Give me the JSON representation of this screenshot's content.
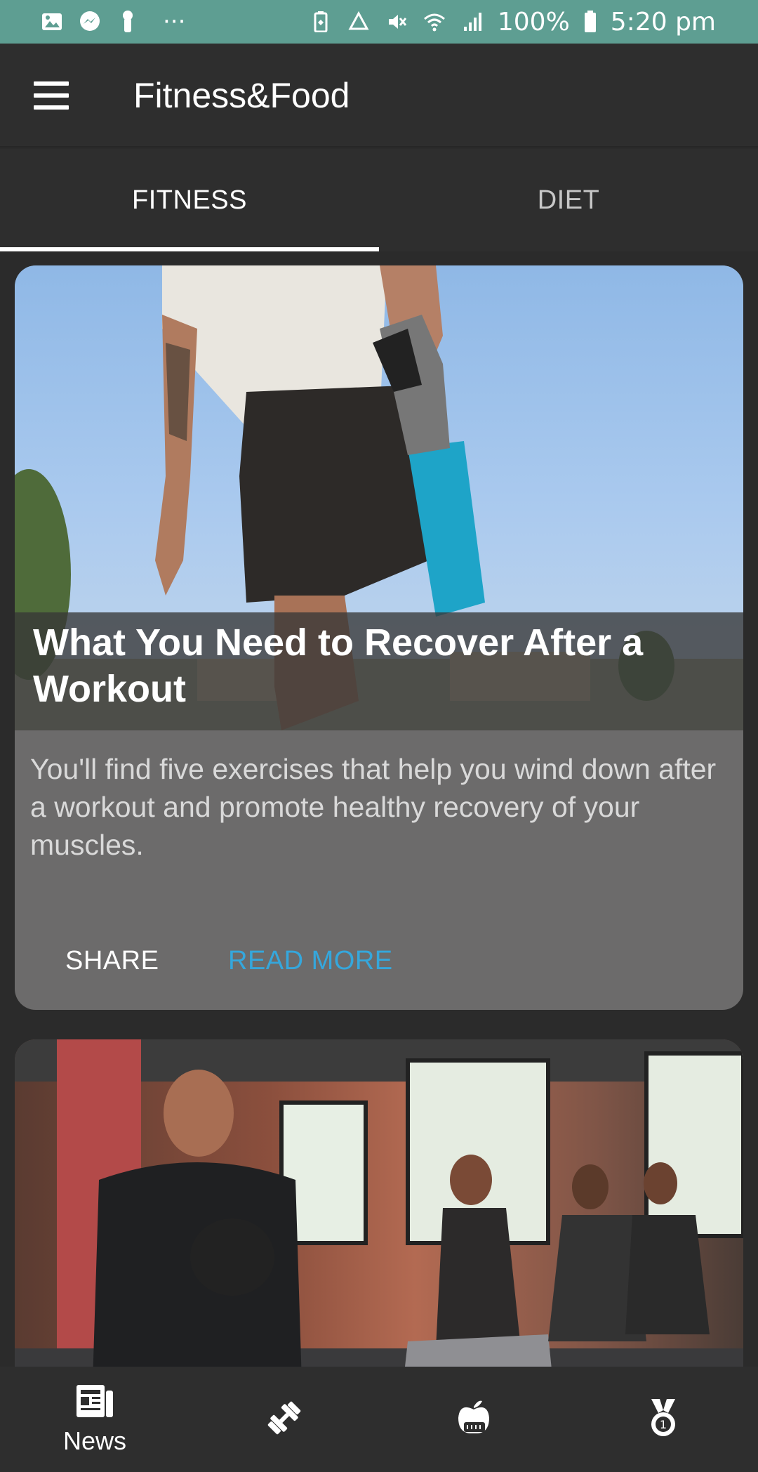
{
  "status_bar": {
    "dots": "···",
    "battery": "100%",
    "time": "5:20 pm",
    "icons": [
      "image-icon",
      "messenger-icon",
      "notification-icon",
      "battery-saver-icon",
      "recycle-icon",
      "mute-icon",
      "wifi-icon",
      "signal-icon",
      "battery-icon"
    ]
  },
  "appbar": {
    "title": "Fitness&Food",
    "menu_icon": "menu-icon"
  },
  "tabs": [
    {
      "label": "FITNESS",
      "active": true
    },
    {
      "label": "DIET",
      "active": false
    }
  ],
  "cards": [
    {
      "title": "What You Need to Recover After a Workout",
      "description": "You'll find five exercises that help you wind down after a workout and promote healthy recovery of your muscles.",
      "actions": {
        "share": "SHARE",
        "read_more": "READ MORE"
      }
    },
    {
      "title": "",
      "description": ""
    }
  ],
  "bottom_nav": [
    {
      "label": "News",
      "icon": "newspaper-icon",
      "active": true
    },
    {
      "label": "",
      "icon": "dumbbell-icon",
      "active": false
    },
    {
      "label": "",
      "icon": "apple-scale-icon",
      "active": false
    },
    {
      "label": "",
      "icon": "medal-icon",
      "active": false
    }
  ],
  "colors": {
    "status_bar": "#5e9e92",
    "app_bar": "#2e2e2e",
    "card": "#6c6b6b",
    "accent": "#35a7dc"
  }
}
